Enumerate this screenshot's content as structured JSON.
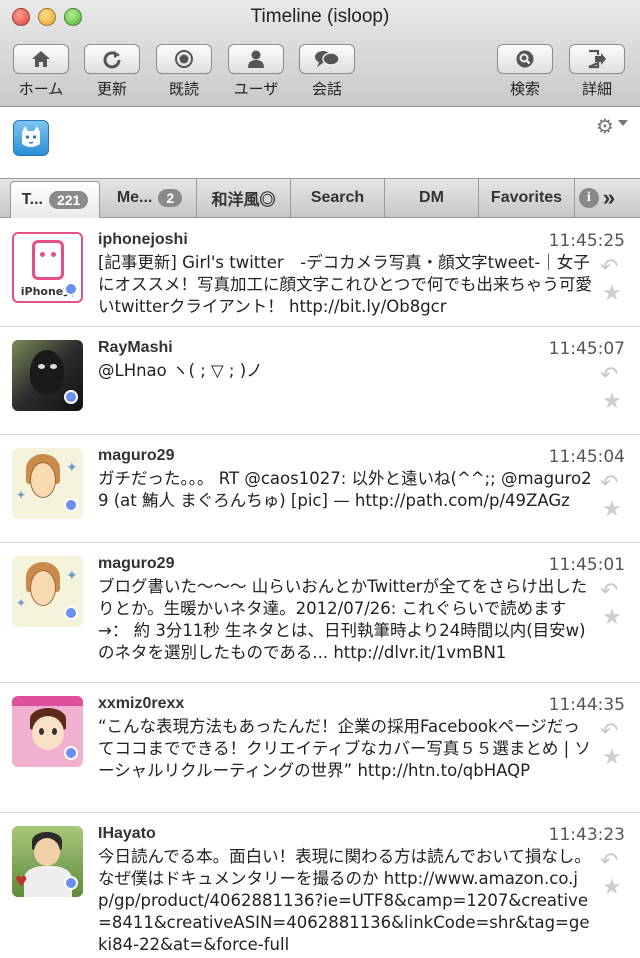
{
  "window": {
    "title": "Timeline (isloop)"
  },
  "toolbar": {
    "home": "ホーム",
    "refresh": "更新",
    "read": "既読",
    "user": "ユーザ",
    "conversation": "会話",
    "search": "検索",
    "detail": "詳細"
  },
  "tabs": [
    {
      "label": "T...",
      "badge": "221"
    },
    {
      "label": "Me...",
      "badge": "2"
    },
    {
      "label": "和洋風◎"
    },
    {
      "label": "Search"
    },
    {
      "label": "DM"
    },
    {
      "label": "Favorites"
    }
  ],
  "tabs_more": "»",
  "tweets": [
    {
      "user": "iphonejoshi",
      "time": "11:45:25",
      "text": "[記事更新] Girl's twitter　-デコカメラ写真・顔文字tweet-｜女子にオススメ！写真加工に顔文字これひとつで何でも出来ちゃう可愛いtwitterクライアント！ http://bit.ly/Ob8gcr",
      "avatar_label": "iPhone女"
    },
    {
      "user": "RayMashi",
      "time": "11:45:07",
      "text": "@LHnao ヽ( ; ▽ ; )ノ"
    },
    {
      "user": "maguro29",
      "time": "11:45:04",
      "text": "ガチだった。。。 RT @caos1027: 以外と遠いね(^^;; @maguro29 (at 鮪人 まぐろんちゅ) [pic] — http://path.com/p/49ZAGz"
    },
    {
      "user": "maguro29",
      "time": "11:45:01",
      "text": "ブログ書いた〜〜〜 山らいおんとかTwitterが全てをさらけ出したりとか。生暖かいネタ達。2012/07/26: これぐらいで読めます→： 約 3分11秒 生ネタとは、日刊執筆時より24時間以内(目安w)のネタを選別したものである... http://dlvr.it/1vmBN1"
    },
    {
      "user": "xxmiz0rexx",
      "time": "11:44:35",
      "text": "“こんな表現方法もあったんだ！企業の採用Facebookページだってココまでできる！クリエイティブなカバー写真５５選まとめ | ソーシャルリクルーティングの世界” http://htn.to/qbHAQP"
    },
    {
      "user": "IHayato",
      "time": "11:43:23",
      "text": "今日読んでる本。面白い！表現に関わる方は読んでおいて損なし。 なぜ僕はドキュメンタリーを撮るのか http://www.amazon.co.jp/gp/product/4062881136?ie=UTF8&camp=1207&creative=8411&creativeASIN=4062881136&linkCode=shr&tag=geki84-22&at=&force-full"
    }
  ],
  "colors": {
    "status_dot": "#6a8ff0",
    "toolbar_top": "#e9e9e9",
    "toolbar_bottom": "#c9c9c9"
  }
}
